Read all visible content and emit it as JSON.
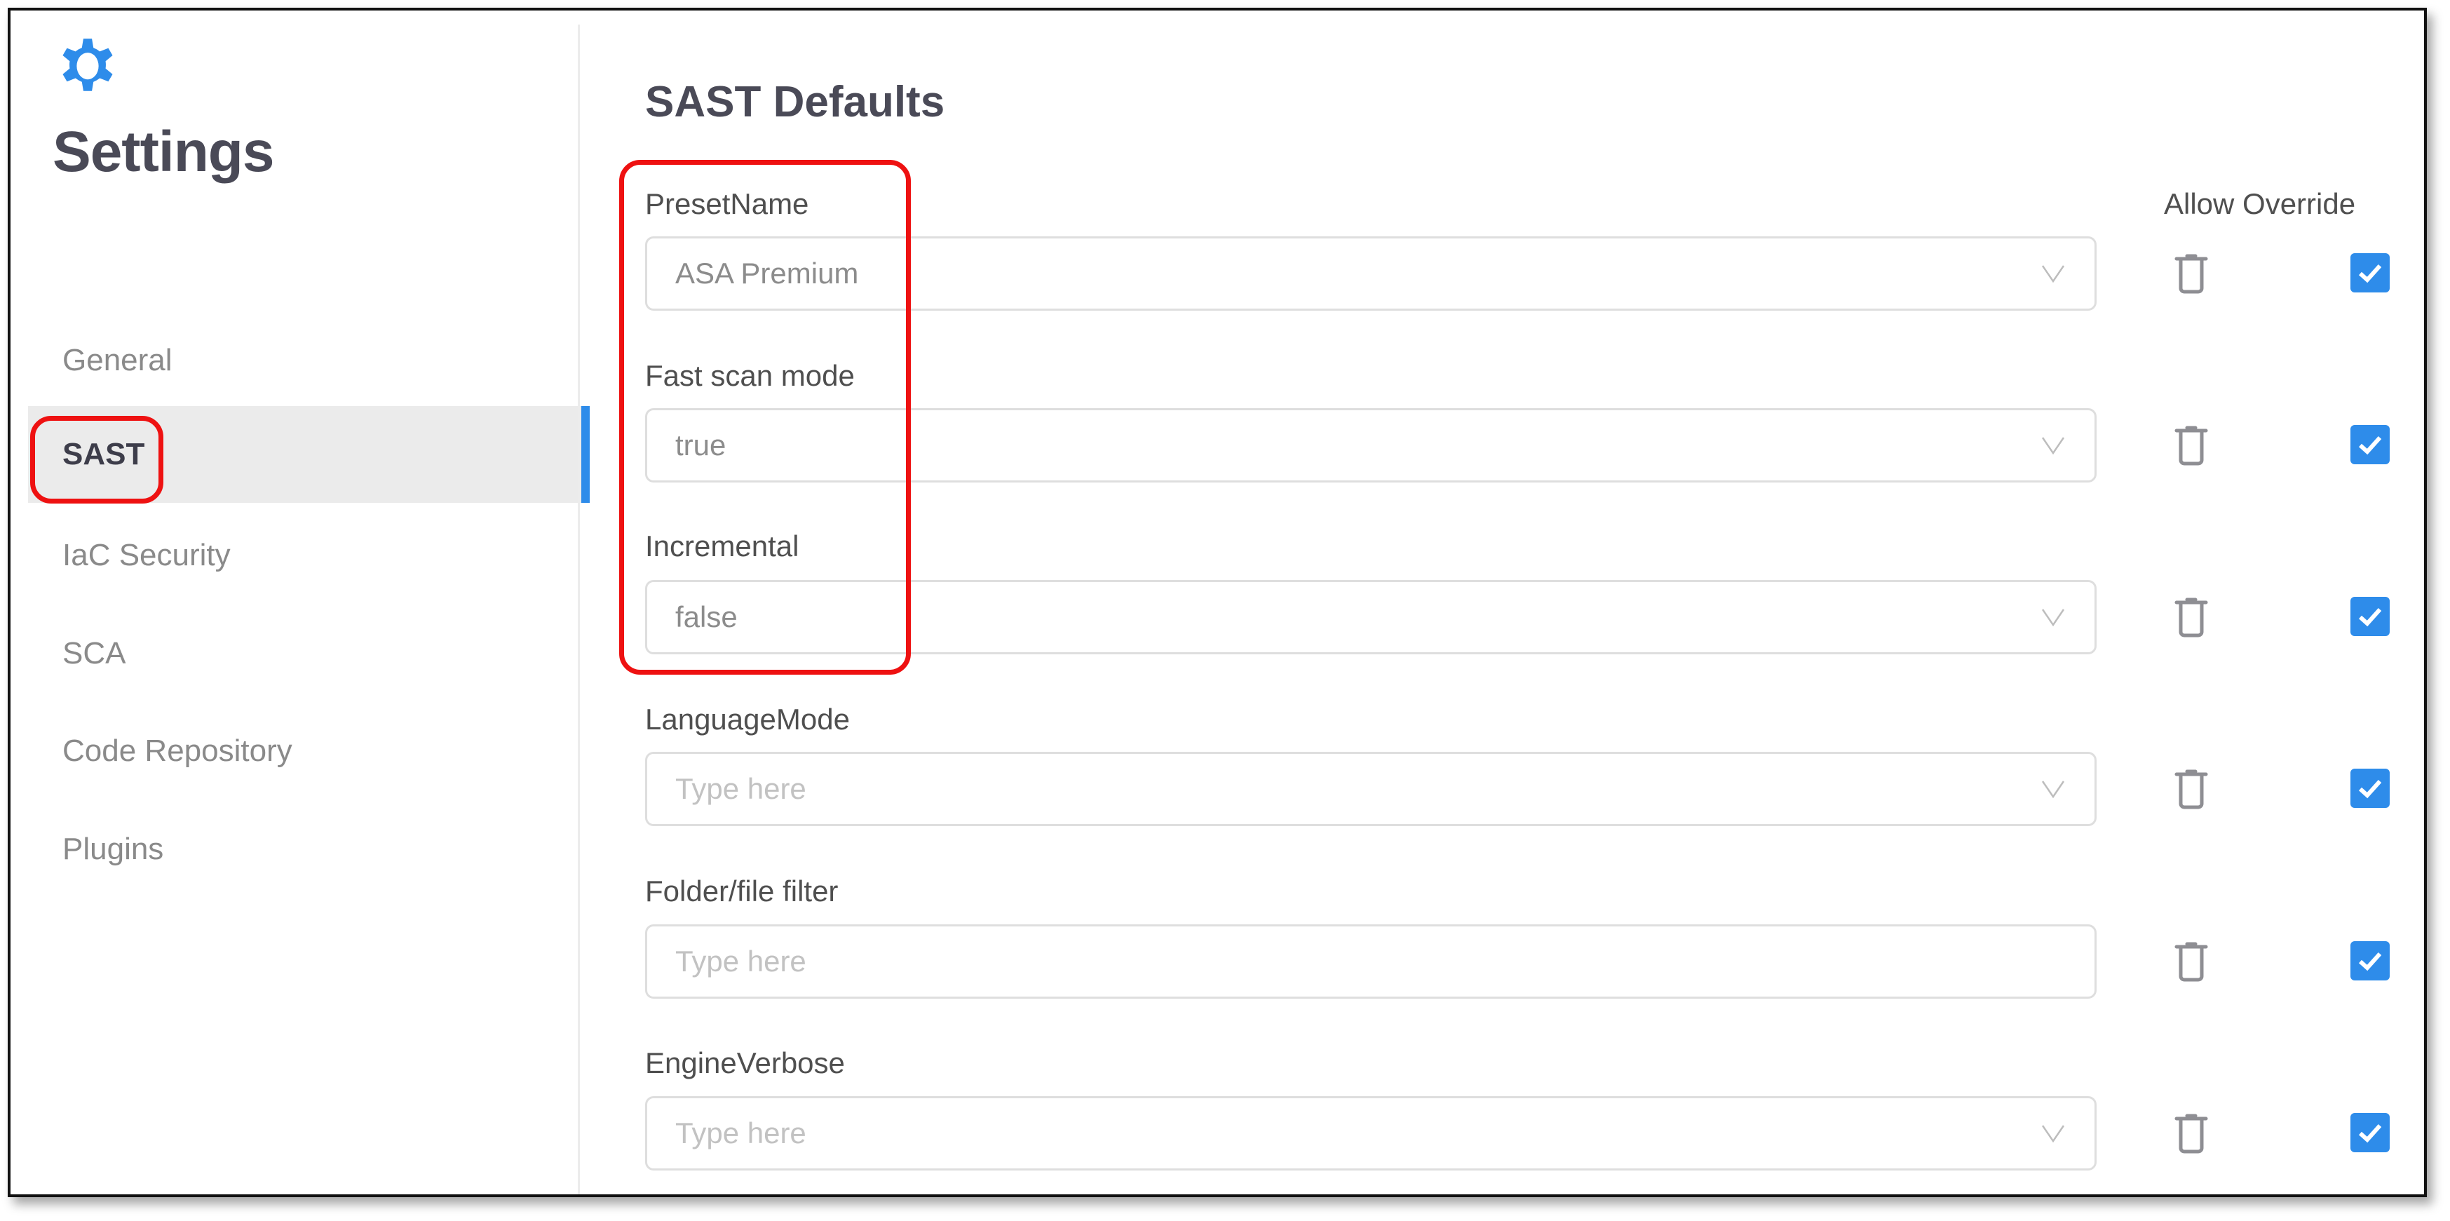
{
  "sidebar": {
    "icon": "gear-icon",
    "title": "Settings",
    "items": [
      {
        "label": "General",
        "active": false
      },
      {
        "label": "SAST",
        "active": true
      },
      {
        "label": "IaC Security",
        "active": false
      },
      {
        "label": "SCA",
        "active": false
      },
      {
        "label": "Code Repository",
        "active": false
      },
      {
        "label": "Plugins",
        "active": false
      }
    ]
  },
  "main": {
    "title": "SAST Defaults",
    "allow_override_header": "Allow Override",
    "fields": [
      {
        "label": "PresetName",
        "value": "ASA Premium",
        "placeholder": "Type here",
        "type": "dropdown",
        "allow_override": true
      },
      {
        "label": "Fast scan mode",
        "value": "true",
        "placeholder": "Type here",
        "type": "dropdown",
        "allow_override": true
      },
      {
        "label": "Incremental",
        "value": "false",
        "placeholder": "Type here",
        "type": "dropdown",
        "allow_override": true
      },
      {
        "label": "LanguageMode",
        "value": "",
        "placeholder": "Type here",
        "type": "dropdown",
        "allow_override": true
      },
      {
        "label": "Folder/file filter",
        "value": "",
        "placeholder": "Type here",
        "type": "text",
        "allow_override": true
      },
      {
        "label": "EngineVerbose",
        "value": "",
        "placeholder": "Type here",
        "type": "dropdown",
        "allow_override": true
      }
    ]
  },
  "colors": {
    "accent": "#2e8cea",
    "annotation": "#ee1111",
    "active_bg": "#ebebeb",
    "title_text": "#4a4a57"
  },
  "annotations": [
    "red-highlight-sast-nav",
    "red-highlight-first-three-fields"
  ]
}
